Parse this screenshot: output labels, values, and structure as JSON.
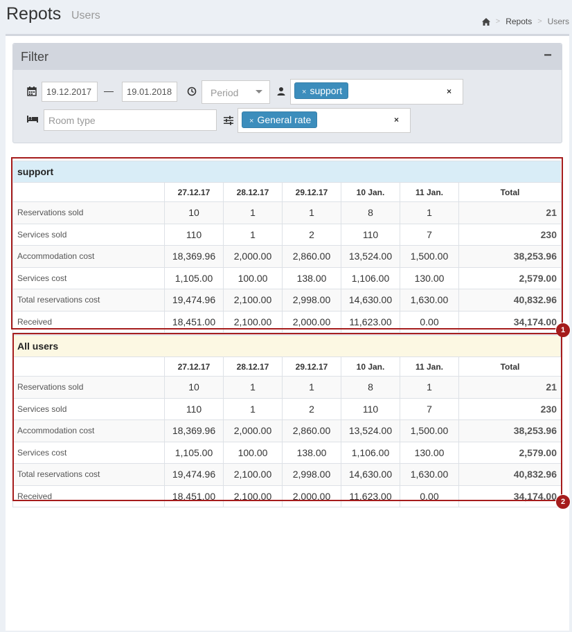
{
  "header": {
    "title": "Repots",
    "subtitle": "Users",
    "breadcrumb": [
      "Repots",
      "Users"
    ],
    "breadcrumb_sep": ">"
  },
  "filter": {
    "title": "Filter",
    "collapse_label": "−",
    "date_from": "19.12.2017",
    "date_to": "19.01.2018",
    "date_sep": "—",
    "period_placeholder": "Period",
    "user_tag": "support",
    "room_type_placeholder": "Room type",
    "rate_tag": "General rate",
    "tag_remove": "×",
    "clear_label": "×"
  },
  "table_headers": [
    "",
    "27.12.17",
    "28.12.17",
    "29.12.17",
    "10 Jan.",
    "11 Jan.",
    "Total"
  ],
  "groups": [
    {
      "name": "support",
      "marker": "1",
      "rows": [
        {
          "label": "Reservations sold",
          "values": [
            "10",
            "1",
            "1",
            "8",
            "1"
          ],
          "total": "21"
        },
        {
          "label": "Services sold",
          "values": [
            "110",
            "1",
            "2",
            "110",
            "7"
          ],
          "total": "230"
        },
        {
          "label": "Accommodation cost",
          "values": [
            "18,369.96",
            "2,000.00",
            "2,860.00",
            "13,524.00",
            "1,500.00"
          ],
          "total": "38,253.96"
        },
        {
          "label": "Services cost",
          "values": [
            "1,105.00",
            "100.00",
            "138.00",
            "1,106.00",
            "130.00"
          ],
          "total": "2,579.00"
        },
        {
          "label": "Total reservations cost",
          "values": [
            "19,474.96",
            "2,100.00",
            "2,998.00",
            "14,630.00",
            "1,630.00"
          ],
          "total": "40,832.96"
        },
        {
          "label": "Received",
          "values": [
            "18,451.00",
            "2,100.00",
            "2,000.00",
            "11,623.00",
            "0.00"
          ],
          "total": "34,174.00"
        }
      ]
    },
    {
      "name": "All users",
      "marker": "2",
      "rows": [
        {
          "label": "Reservations sold",
          "values": [
            "10",
            "1",
            "1",
            "8",
            "1"
          ],
          "total": "21"
        },
        {
          "label": "Services sold",
          "values": [
            "110",
            "1",
            "2",
            "110",
            "7"
          ],
          "total": "230"
        },
        {
          "label": "Accommodation cost",
          "values": [
            "18,369.96",
            "2,000.00",
            "2,860.00",
            "13,524.00",
            "1,500.00"
          ],
          "total": "38,253.96"
        },
        {
          "label": "Services cost",
          "values": [
            "1,105.00",
            "100.00",
            "138.00",
            "1,106.00",
            "130.00"
          ],
          "total": "2,579.00"
        },
        {
          "label": "Total reservations cost",
          "values": [
            "19,474.96",
            "2,100.00",
            "2,998.00",
            "14,630.00",
            "1,630.00"
          ],
          "total": "40,832.96"
        },
        {
          "label": "Received",
          "values": [
            "18,451.00",
            "2,100.00",
            "2,000.00",
            "11,623.00",
            "0.00"
          ],
          "total": "34,174.00"
        }
      ]
    }
  ],
  "colors": {
    "accent": "#3c8dbc",
    "highlight": "#a51c1c",
    "support_header": "#d9edf7",
    "all_users_header": "#fcf8e3"
  }
}
